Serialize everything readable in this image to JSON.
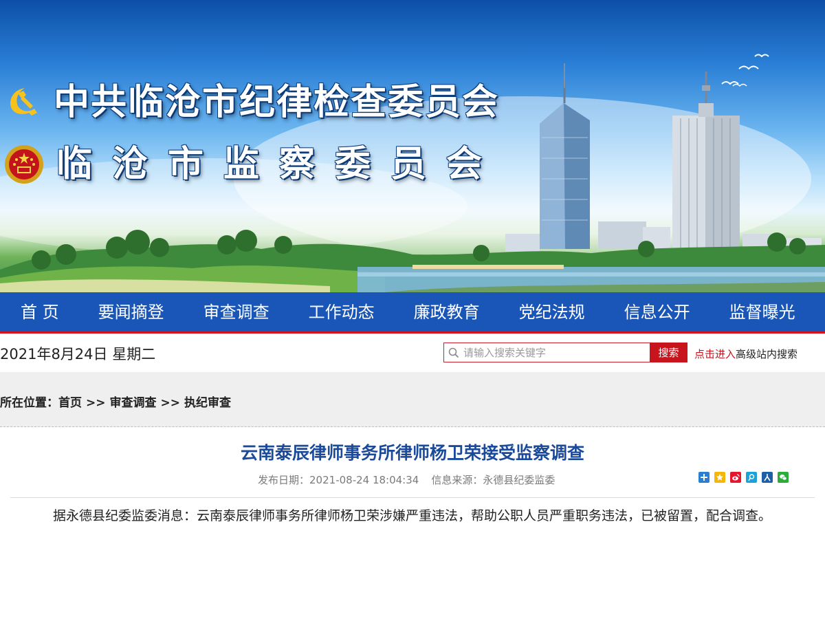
{
  "banner": {
    "org_name_1": "中共临沧市纪律检查委员会",
    "org_name_2": "临沧市监察委员会"
  },
  "nav": {
    "items": [
      {
        "label": "首 页"
      },
      {
        "label": "要闻摘登"
      },
      {
        "label": "审查调查"
      },
      {
        "label": "工作动态"
      },
      {
        "label": "廉政教育"
      },
      {
        "label": "党纪法规"
      },
      {
        "label": "信息公开"
      },
      {
        "label": "监督曝光"
      }
    ]
  },
  "toolbar": {
    "date": "2021年8月24日 星期二",
    "search_placeholder": "请输入搜索关键字",
    "search_button": "搜索",
    "advanced_link": "点击进入",
    "advanced_text": "高级站内搜索"
  },
  "breadcrumb": {
    "label": "所在位置：",
    "items": [
      "首页",
      "审查调查",
      "执纪审查"
    ],
    "separator": ">>"
  },
  "article": {
    "title": "云南泰辰律师事务所律师杨卫荣接受监察调查",
    "publish_label": "发布日期：",
    "publish_date": "2021-08-24 18:04:34",
    "source_label": "信息来源：",
    "source": "永德县纪委监委",
    "body": "据永德县纪委监委消息：云南泰辰律师事务所律师杨卫荣涉嫌严重违法，帮助公职人员严重职务违法，已被留置，配合调查。"
  },
  "share": {
    "icons": [
      "share-more-icon",
      "qzone-icon",
      "weibo-icon",
      "tencent-weibo-icon",
      "renren-icon",
      "wechat-icon"
    ]
  },
  "colors": {
    "nav_bg": "#1a56b8",
    "nav_border": "#d8121a",
    "search_button": "#c8151d",
    "title": "#1b4a9a",
    "crumb_bg": "#efefef"
  }
}
